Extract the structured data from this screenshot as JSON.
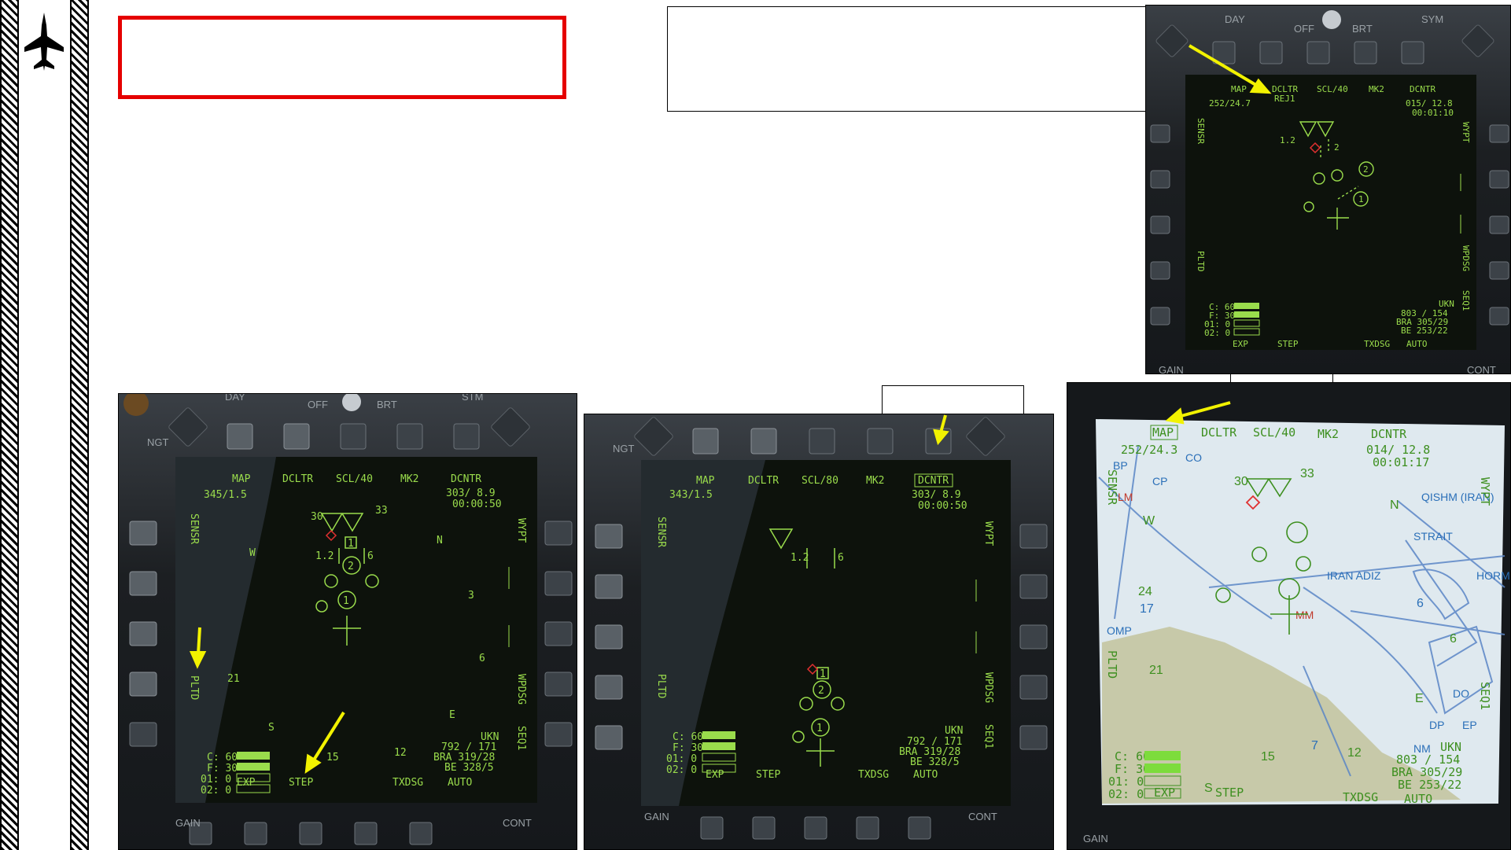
{
  "accent": {
    "arrow": "#f2f200",
    "symbology": "#9adc4c",
    "hostile": "#e03030",
    "box": "#e50000"
  },
  "sidebar": {
    "icon": "fighter-jet-icon"
  },
  "mfd_top": {
    "bezel": {
      "day": "DAY",
      "off": "OFF",
      "brt": "BRT",
      "sym": "SYM",
      "gain": "GAIN",
      "cont": "CONT"
    },
    "top": {
      "map": "MAP",
      "dcltr": "DCLTR",
      "dcltr_sub": "REJ1",
      "scl": "SCL/40",
      "mk": "MK2",
      "dcntr": "DCNTR"
    },
    "readout_left": "252/24.7",
    "readout_right": [
      "015/ 12.8",
      "00:01:10"
    ],
    "left_side": {
      "sensr": "SENSR",
      "pltd": "PLTD"
    },
    "right_side": {
      "wypt": "WYPT",
      "wpdsg": "WPDSG",
      "seq": "SEQ1"
    },
    "stores": [
      "C: 60",
      "F: 30",
      "01:  0",
      "02:  0"
    ],
    "bottom": {
      "exp": "EXP",
      "step": "STEP",
      "txdsg": "TXDSG",
      "auto": "AUTO"
    },
    "bra": [
      "UKN",
      "803 / 154",
      "BRA 305/29",
      "BE 253/22"
    ],
    "contacts": [
      "1.2",
      "2",
      "1",
      "2"
    ]
  },
  "mfd_left": {
    "bezel": {
      "ngt": "NGT",
      "day": "DAY",
      "off": "OFF",
      "brt": "BRT",
      "sym": "STM",
      "gain": "GAIN",
      "cont": "CONT"
    },
    "top": {
      "map": "MAP",
      "dcltr": "DCLTR",
      "scl": "SCL/40",
      "mk": "MK2",
      "dcntr": "DCNTR"
    },
    "readout_left": "345/1.5",
    "readout_right": [
      "303/  8.9",
      "00:00:50"
    ],
    "left_side": {
      "sensr": "SENSR",
      "pltd": "PLTD"
    },
    "right_side": {
      "wypt": "WYPT",
      "wpdsg": "WPDSG",
      "seq": "SEQ1"
    },
    "compass": {
      "n": "N",
      "w": "W",
      "e": "E",
      "s": "S",
      "n30": "30",
      "n33": "33",
      "n3": "3",
      "n6": "6",
      "n21": "21",
      "n15": "15",
      "n12": "12"
    },
    "stores": [
      "C: 60",
      "F: 30",
      "01:  0",
      "02:  0"
    ],
    "bottom": {
      "exp": "EXP",
      "step": "STEP",
      "txdsg": "TXDSG",
      "auto": "AUTO"
    },
    "bra": [
      "UKN",
      "792 / 171",
      "BRA 319/28",
      "BE 328/5"
    ],
    "contacts": [
      "1.2",
      "1",
      "6",
      "2",
      "1"
    ]
  },
  "mfd_mid": {
    "bezel": {
      "ngt": "NGT",
      "gain": "GAIN",
      "cont": "CONT"
    },
    "top": {
      "map": "MAP",
      "dcltr": "DCLTR",
      "scl": "SCL/80",
      "mk": "MK2",
      "dcntr": "DCNTR"
    },
    "readout_left": "343/1.5",
    "readout_right": [
      "303/  8.9",
      "00:00:50"
    ],
    "left_side": {
      "sensr": "SENSR",
      "pltd": "PLTD"
    },
    "right_side": {
      "wypt": "WYPT",
      "wpdsg": "WPDSG",
      "seq": "SEQ1"
    },
    "stores": [
      "C: 60",
      "F: 30",
      "01:  0",
      "02:  0"
    ],
    "bottom": {
      "exp": "EXP",
      "step": "STEP",
      "txdsg": "TXDSG",
      "auto": "AUTO"
    },
    "bra": [
      "UKN",
      "792 / 171",
      "BRA 319/28",
      "BE 328/5"
    ],
    "contacts": [
      "1.2",
      "6",
      "1",
      "2",
      "1"
    ]
  },
  "mfd_map": {
    "bezel": {
      "gain": "GAIN"
    },
    "top": {
      "map": "MAP",
      "dcltr": "DCLTR",
      "scl": "SCL/40",
      "mk": "MK2",
      "dcntr": "DCNTR"
    },
    "readout_left": "252/24.3",
    "readout_right": [
      "014/ 12.8",
      "00:01:17"
    ],
    "left_side": {
      "sensr": "SENSR",
      "pltd": "PLTD"
    },
    "right_side": {
      "wypt": "WYPT",
      "wpdsg": "WPDSG",
      "seq": "SEQ1"
    },
    "map_text": [
      "30",
      "33",
      "W",
      "N",
      "24",
      "21",
      "17",
      "15",
      "12",
      "6",
      "E",
      "7",
      "6",
      "S",
      "IRAN ADIZ",
      "QISHM (IRAN)",
      "STRAIT",
      "HORMUZ",
      "BP",
      "CP",
      "LM",
      "CO",
      "DO",
      "DP",
      "EP",
      "NM",
      "MM",
      "OMP"
    ],
    "stores": [
      "C: 60",
      "F: 30",
      "01:  0",
      "02:  0"
    ],
    "bottom": {
      "exp": "EXP",
      "step": "STEP",
      "txdsg": "TXDSG",
      "auto": "AUTO"
    },
    "bra": [
      "UKN",
      "803 / 154",
      "BRA 305/29",
      "BE 253/22"
    ]
  }
}
